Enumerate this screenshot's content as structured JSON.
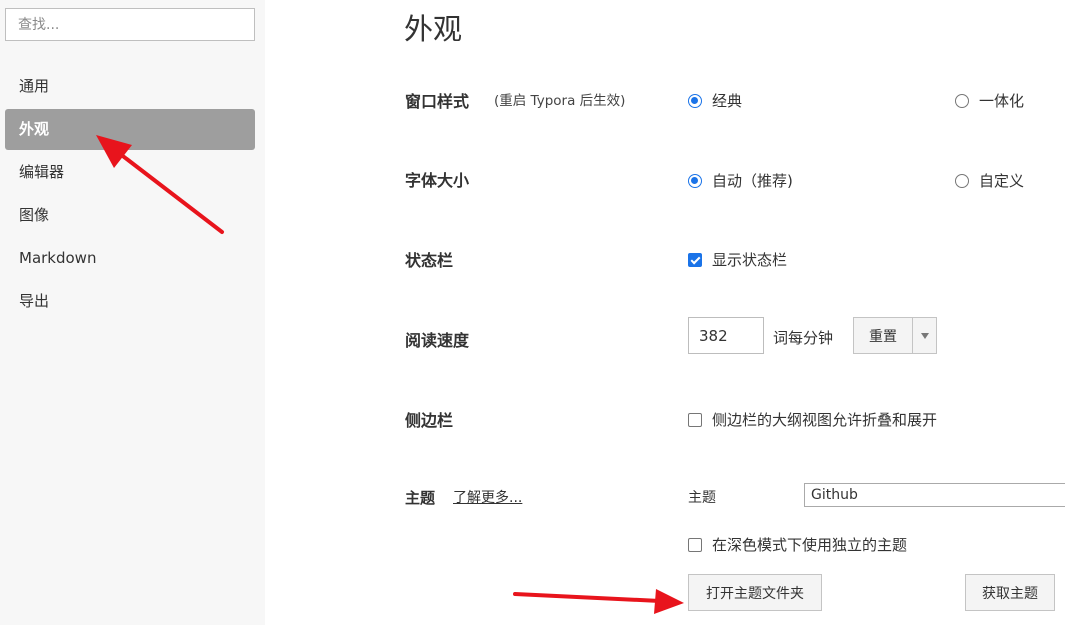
{
  "sidebar": {
    "search_placeholder": "查找...",
    "items": [
      {
        "label": "通用"
      },
      {
        "label": "外观",
        "active": true
      },
      {
        "label": "编辑器"
      },
      {
        "label": "图像"
      },
      {
        "label": "Markdown"
      },
      {
        "label": "导出"
      }
    ]
  },
  "page": {
    "title": "外观"
  },
  "window_style": {
    "label": "窗口样式",
    "note": "(重启 Typora 后生效)",
    "options": [
      {
        "label": "经典",
        "selected": true
      },
      {
        "label": "一体化",
        "selected": false
      }
    ]
  },
  "font_size": {
    "label": "字体大小",
    "options": [
      {
        "label": "自动（推荐)",
        "selected": true
      },
      {
        "label": "自定义",
        "selected": false
      }
    ]
  },
  "status_bar": {
    "label": "状态栏",
    "checkbox_label": "显示状态栏",
    "checked": true
  },
  "reading_speed": {
    "label": "阅读速度",
    "value": "382",
    "unit": "词每分钟",
    "reset_label": "重置"
  },
  "sidebar_section": {
    "label": "侧边栏",
    "checkbox_label": "侧边栏的大纲视图允许折叠和展开",
    "checked": false
  },
  "theme": {
    "label": "主题",
    "learn_more": "了解更多...",
    "select_label": "主题",
    "selected": "Github",
    "dark_mode_label": "在深色模式下使用独立的主题",
    "dark_mode_checked": false,
    "open_folder_label": "打开主题文件夹",
    "get_themes_label": "获取主题"
  },
  "colors": {
    "accent": "#1a73e8",
    "sidebar_active": "#9e9e9e",
    "annotation_arrow": "#e8141c"
  }
}
